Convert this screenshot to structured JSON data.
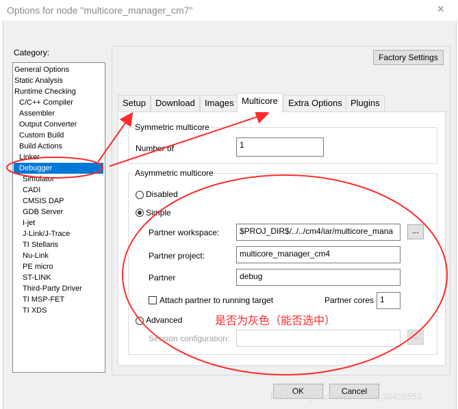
{
  "window": {
    "title": "Options for node \"multicore_manager_cm7\"",
    "close_glyph": "×"
  },
  "category": {
    "label": "Category:",
    "items": [
      "General Options",
      "Static Analysis",
      "Runtime Checking",
      "C/C++ Compiler",
      "Assembler",
      "Output Converter",
      "Custom Build",
      "Build Actions",
      "Linker",
      "Debugger",
      "Simulator",
      "CADI",
      "CMSIS DAP",
      "GDB Server",
      "I-jet",
      "J-Link/J-Trace",
      "TI Stellaris",
      "Nu-Link",
      "PE micro",
      "ST-LINK",
      "Third-Party Driver",
      "TI MSP-FET",
      "TI XDS"
    ],
    "selected": "Debugger"
  },
  "factory_settings": "Factory Settings",
  "tabs": [
    "Setup",
    "Download",
    "Images",
    "Multicore",
    "Extra Options",
    "Plugins"
  ],
  "active_tab": "Multicore",
  "symmetric": {
    "title": "Symmetric multicore",
    "number_of_label": "Number of",
    "value": "1"
  },
  "asymmetric": {
    "title": "Asymmetric multicore",
    "disabled_label": "Disabled",
    "simple_label": "Simple",
    "selected_mode": "Simple",
    "partner_workspace_label": "Partner workspace:",
    "partner_workspace_value": "$PROJ_DIR$/../../cm4/iar/multicore_mana",
    "browse_label": "...",
    "partner_project_label": "Partner project:",
    "partner_project_value": "multicore_manager_cm4",
    "partner_label": "Partner",
    "partner_value": "debug",
    "attach_label": "Attach partner to running target",
    "attach_checked": false,
    "partner_cores_label": "Partner cores",
    "partner_cores_value": "1",
    "advanced_label": "Advanced",
    "session_config_label": "Session configuration:",
    "session_config_value": ""
  },
  "annotation": {
    "text": "是否为灰色（能否选中）",
    "color": "#ff2a2a"
  },
  "buttons": {
    "ok": "OK",
    "cancel": "Cancel"
  },
  "watermark": "https://blog.csdn.net/weixin_38426553",
  "colors": {
    "selection": "#0078d7",
    "annotation": "#ff2a2a"
  },
  "icons": [
    "close-icon",
    "radio-icon",
    "checkbox-icon",
    "arrow-annotation",
    "ellipse-annotation"
  ]
}
